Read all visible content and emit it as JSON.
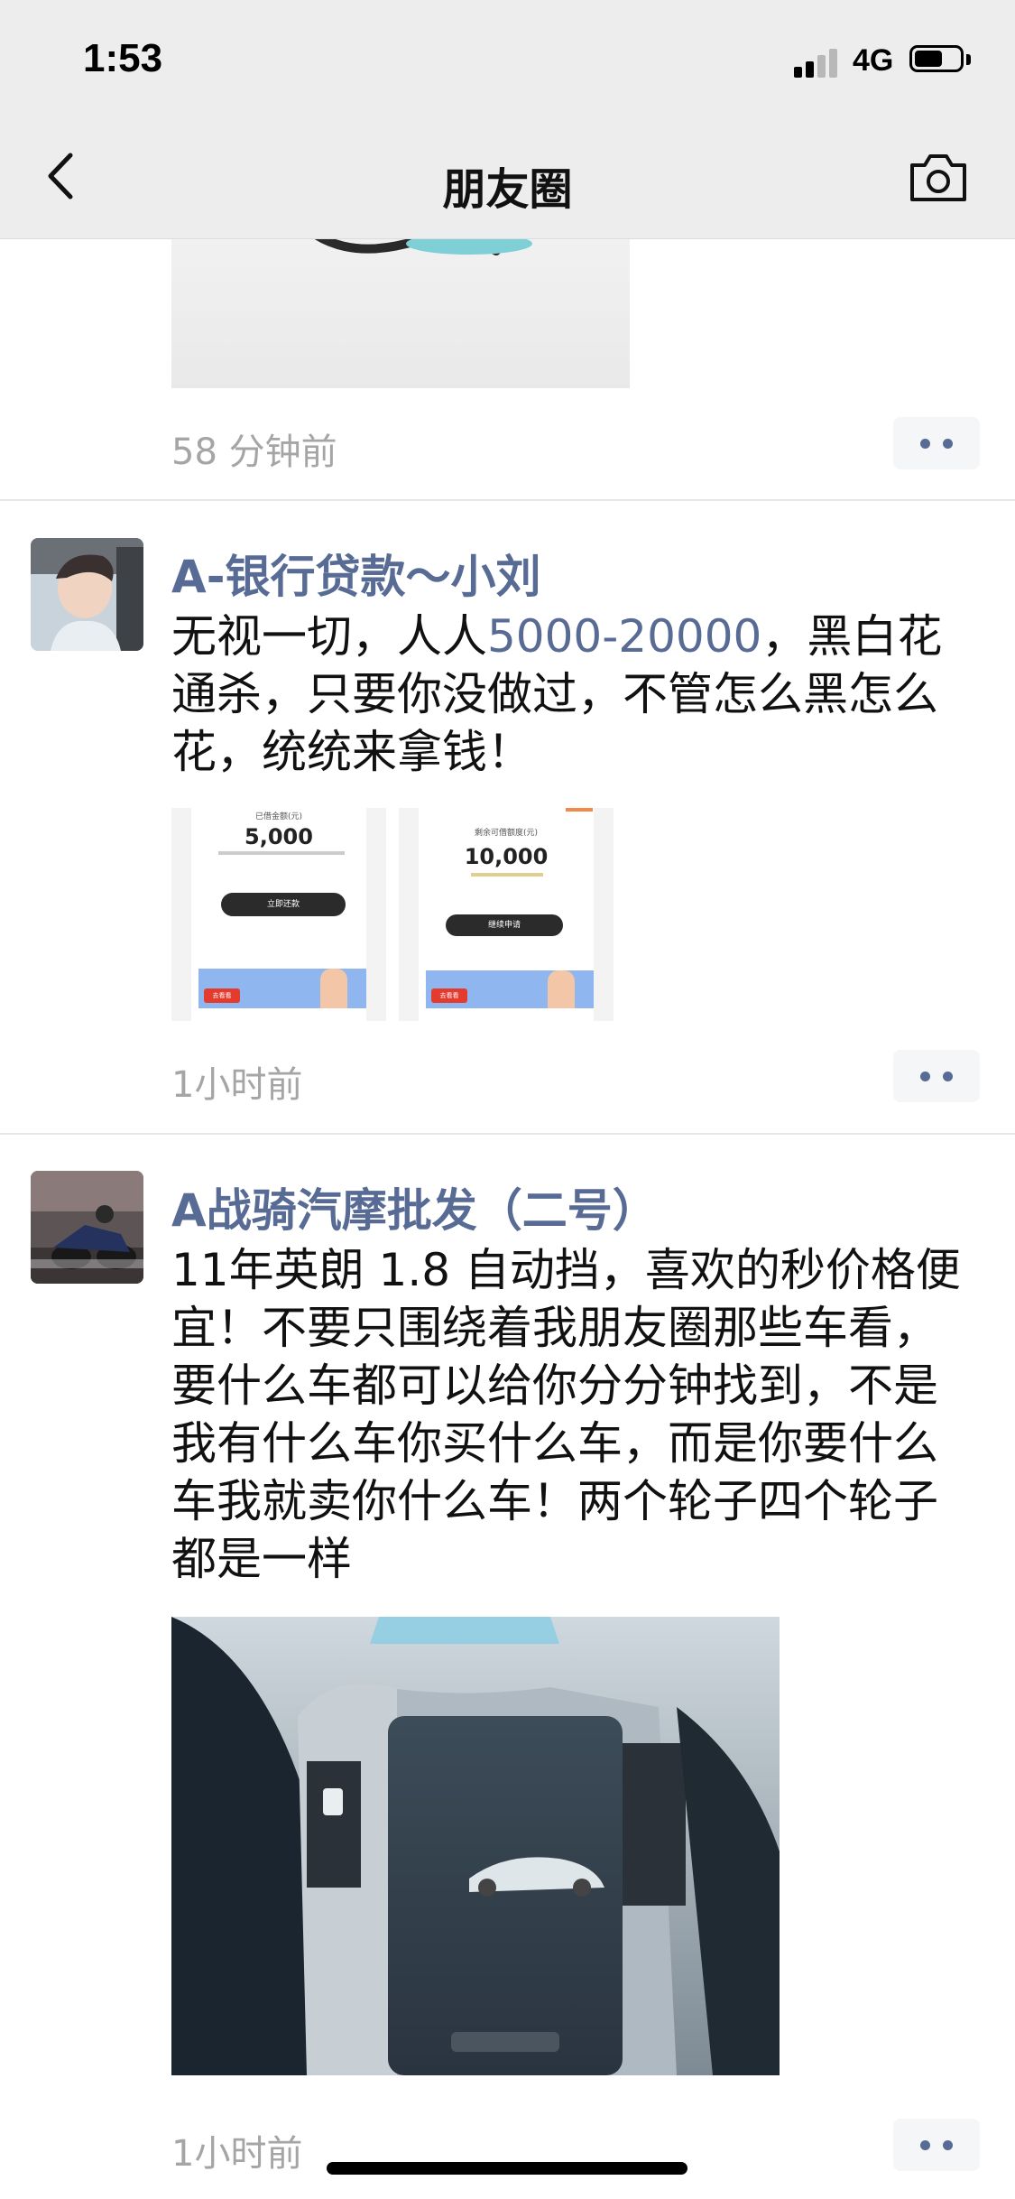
{
  "status_bar": {
    "time": "1:53",
    "network": "4G"
  },
  "nav": {
    "title": "朋友圈"
  },
  "posts": [
    {
      "time": "58 分钟前"
    },
    {
      "author": "A-银行贷款～小刘",
      "content_pre": "无视一切，人人",
      "content_highlight": "5000-20000",
      "content_post": "，黑白花通杀，只要你没做过，不管怎么黑怎么花，统统来拿钱！",
      "images": [
        {
          "header": "已借金额(元)",
          "amount": "5,000",
          "button": "立即还款",
          "banner_btn": "去看看"
        },
        {
          "header": "剩余可借额度(元)",
          "amount": "10,000",
          "button": "继续申请",
          "banner_btn": "去看看"
        }
      ],
      "time": "1小时前"
    },
    {
      "author": "A战骑汽摩批发（二号）",
      "content": "11年英朗 1.8 自动挡，喜欢的秒价格便宜！不要只围绕着我朋友圈那些车看，要什么车都可以给你分分钟找到，不是我有什么车你买什么车，而是你要什么车我就卖你什么车！两个轮子四个轮子都是一样",
      "time": "1小时前"
    }
  ],
  "icons": {
    "back": "chevron-left-icon",
    "camera": "camera-icon",
    "more": "more-dots-icon"
  },
  "colors": {
    "link_blue": "#576b95",
    "nav_bg": "#ededed",
    "timestamp_gray": "#a5a5a5"
  }
}
